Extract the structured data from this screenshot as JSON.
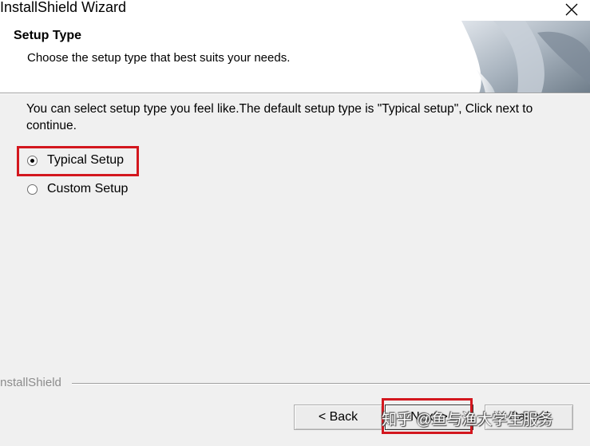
{
  "window": {
    "title": "InstallShield Wizard",
    "close_icon": "close-icon"
  },
  "header": {
    "title": "Setup Type",
    "subtitle": "Choose the setup type that best suits your needs.",
    "art_icon": "installshield-banner-art"
  },
  "content": {
    "instructions": "You can select setup type you feel like.The default setup type is \"Typical setup\", Click next to continue.",
    "options": [
      {
        "label": "Typical Setup",
        "selected": true
      },
      {
        "label": "Custom Setup",
        "selected": false
      }
    ]
  },
  "footer": {
    "brand": "InstallShield",
    "back_label": "< Back",
    "next_label": "Next >",
    "cancel_label": "Cancel"
  },
  "watermark": "知乎 @鱼与渔大学生服务",
  "colors": {
    "highlight": "#d3171e",
    "window_bg": "#f0f0f0",
    "header_bg": "#ffffff"
  }
}
